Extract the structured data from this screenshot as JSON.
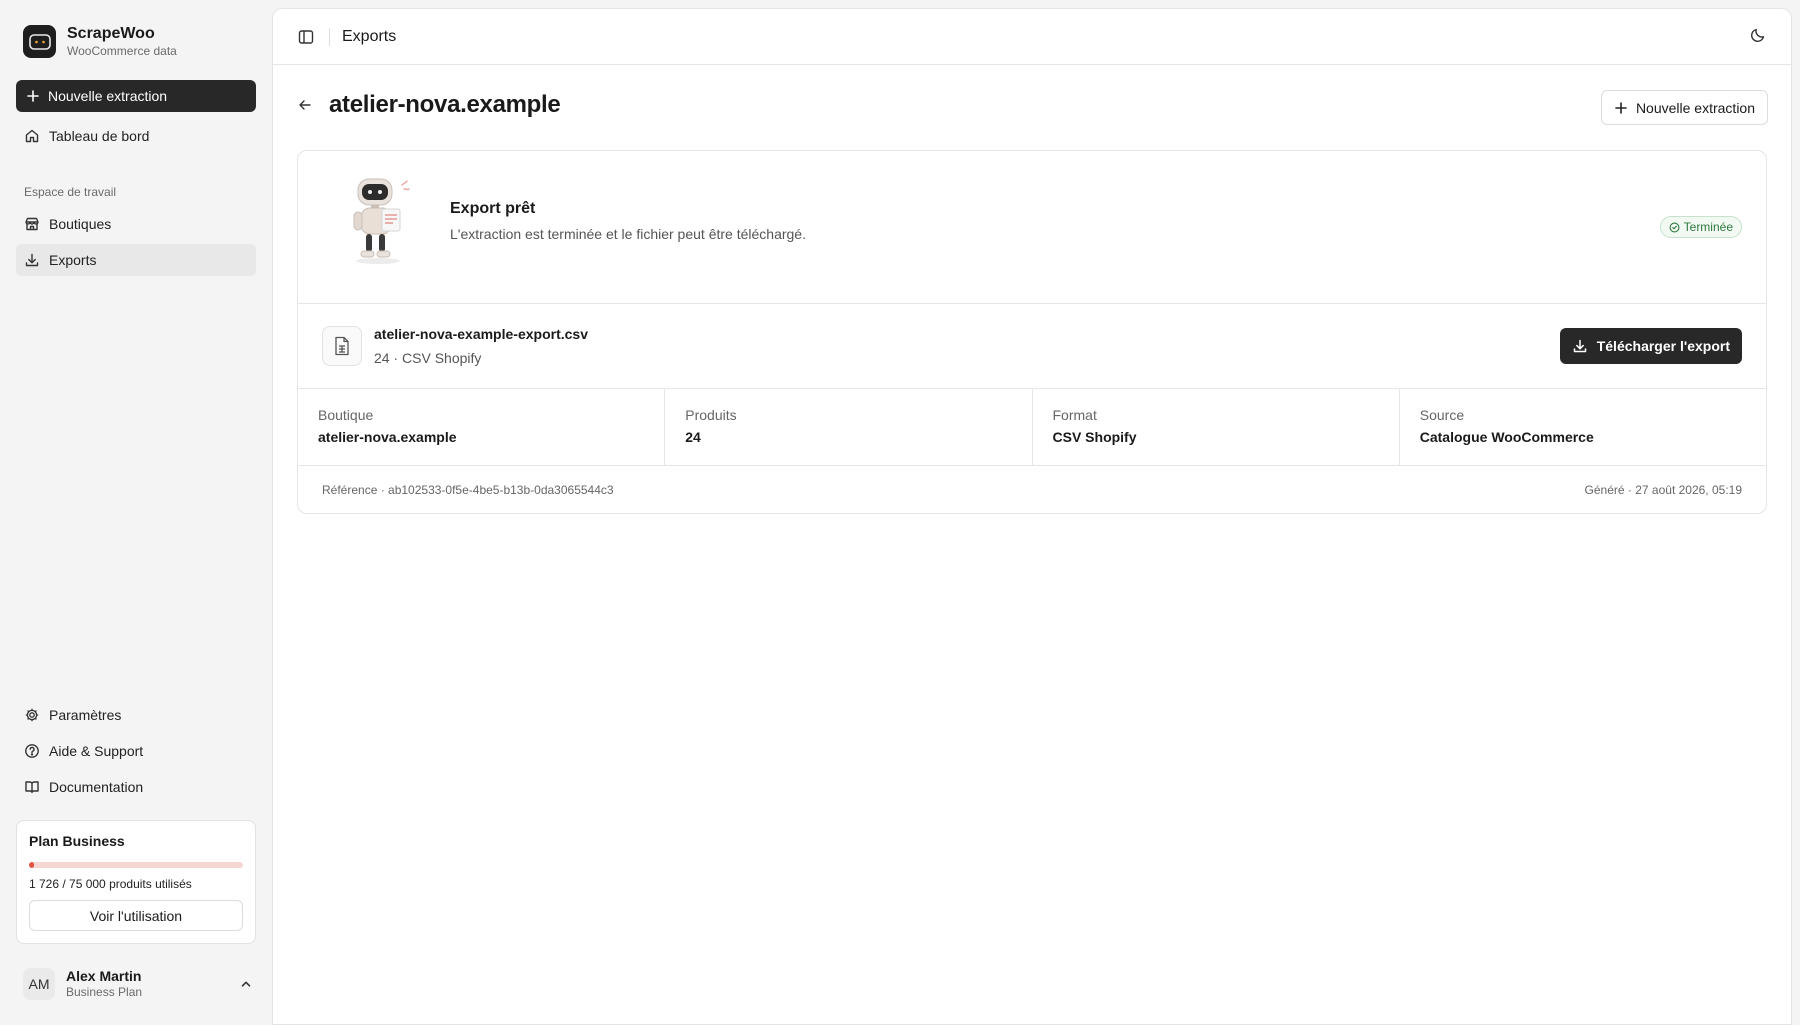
{
  "brand": {
    "name": "ScrapeWoo",
    "subtitle": "WooCommerce data"
  },
  "sidebar": {
    "new_extraction": "Nouvelle extraction",
    "dashboard": "Tableau de bord",
    "section_label": "Espace de travail",
    "items": [
      {
        "label": "Boutiques",
        "icon": "store-icon"
      },
      {
        "label": "Exports",
        "icon": "download-icon",
        "active": true
      }
    ],
    "footer_items": [
      {
        "label": "Paramètres",
        "icon": "gear-icon"
      },
      {
        "label": "Aide & Support",
        "icon": "help-circle-icon"
      },
      {
        "label": "Documentation",
        "icon": "book-icon"
      }
    ],
    "plan": {
      "title": "Plan Business",
      "usage_text": "1 726 / 75 000 produits utilisés",
      "used": 1726,
      "total": 75000,
      "button": "Voir l'utilisation",
      "bar_color": "#e0533f"
    },
    "user": {
      "initials": "AM",
      "name": "Alex Martin",
      "plan": "Business Plan"
    }
  },
  "topbar": {
    "title": "Exports"
  },
  "page": {
    "title": "atelier-nova.example",
    "new_extraction": "Nouvelle extraction"
  },
  "export": {
    "ready_title": "Export prêt",
    "ready_desc": "L'extraction est terminée et le fichier peut être téléchargé.",
    "status": "Terminée",
    "file_name": "atelier-nova-example-export.csv",
    "file_meta": "24 · CSV Shopify",
    "download": "Télécharger l'export",
    "details": [
      {
        "label": "Boutique",
        "value": "atelier-nova.example"
      },
      {
        "label": "Produits",
        "value": "24"
      },
      {
        "label": "Format",
        "value": "CSV Shopify"
      },
      {
        "label": "Source",
        "value": "Catalogue WooCommerce"
      }
    ],
    "reference": "Référence · ab102533-0f5e-4be5-b13b-0da3065544c3",
    "generated": "Généré · 27 août 2026, 05:19"
  }
}
